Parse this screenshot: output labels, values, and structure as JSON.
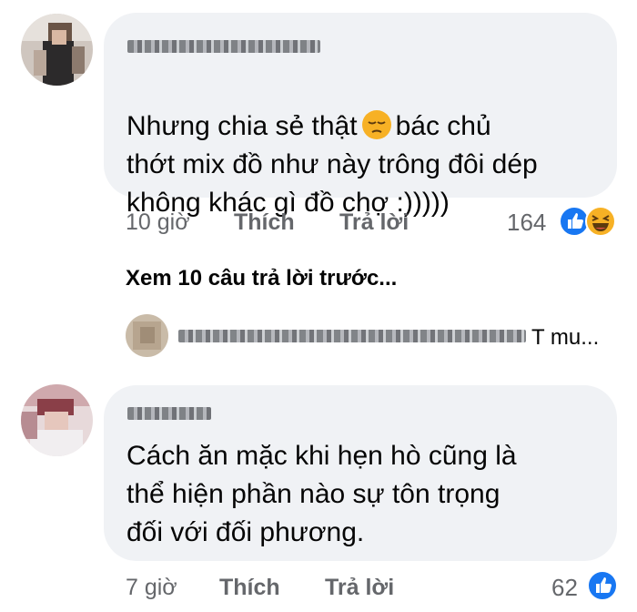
{
  "comments": [
    {
      "text": "Nhưng chia sẻ thật",
      "text_after_emoji": "bác chủ\nthớt mix đồ như này trông đôi dép\nkhông khác gì đồ chợ :)))))",
      "emoji": "pensive-face",
      "time": "10 giờ",
      "like_label": "Thích",
      "reply_label": "Trả lời",
      "reaction_count": "164",
      "reactions": [
        "like",
        "haha"
      ]
    },
    {
      "text": "Cách ăn mặc khi hẹn hò cũng là\nthể hiện phần nào sự tôn trọng\nđối với đối phương.",
      "time": "7 giờ",
      "like_label": "Thích",
      "reply_label": "Trả lời",
      "reaction_count": "62",
      "reactions": [
        "like"
      ]
    }
  ],
  "replies_link": "Xem 10 câu trả lời trước...",
  "reply_preview": {
    "visible_text": "T mu..."
  },
  "colors": {
    "bubble": "#f0f2f5",
    "secondary_text": "#65676b",
    "like_blue": "#1877f2",
    "haha_yellow": "#f7b125"
  }
}
